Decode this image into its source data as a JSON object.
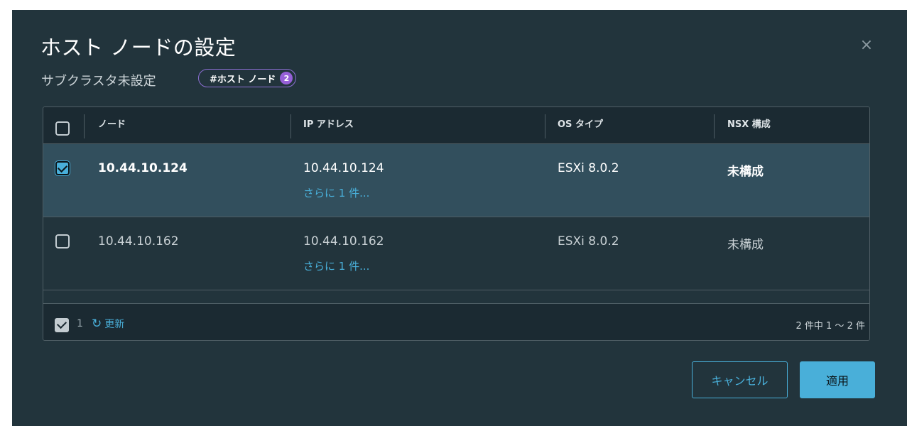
{
  "dialog": {
    "title": "ホスト ノードの設定",
    "subtitle": "サブクラスタ未設定",
    "tag": {
      "label": "#ホスト ノード",
      "count": "2"
    },
    "close_icon": "×"
  },
  "table": {
    "columns": [
      "ノード",
      "IP アドレス",
      "OS タイプ",
      "NSX 構成"
    ],
    "rows": [
      {
        "selected": true,
        "node": "10.44.10.124",
        "ip": "10.44.10.124",
        "more": "さらに 1 件...",
        "os": "ESXi 8.0.2",
        "nsx": "未構成"
      },
      {
        "selected": false,
        "node": "10.44.10.162",
        "ip": "10.44.10.162",
        "more": "さらに 1 件...",
        "os": "ESXi 8.0.2",
        "nsx": "未構成"
      }
    ],
    "footer": {
      "selected_count": "1",
      "refresh_icon": "refresh-icon",
      "refresh_label": "更新",
      "pagination": "2 件中 1 ～ 2 件"
    }
  },
  "buttons": {
    "cancel": "キャンセル",
    "apply": "適用"
  },
  "colors": {
    "modal_bg": "#22343c",
    "accent": "#49afd9",
    "selected_row": "#324f5d",
    "tag_border": "#8c6fd3"
  }
}
